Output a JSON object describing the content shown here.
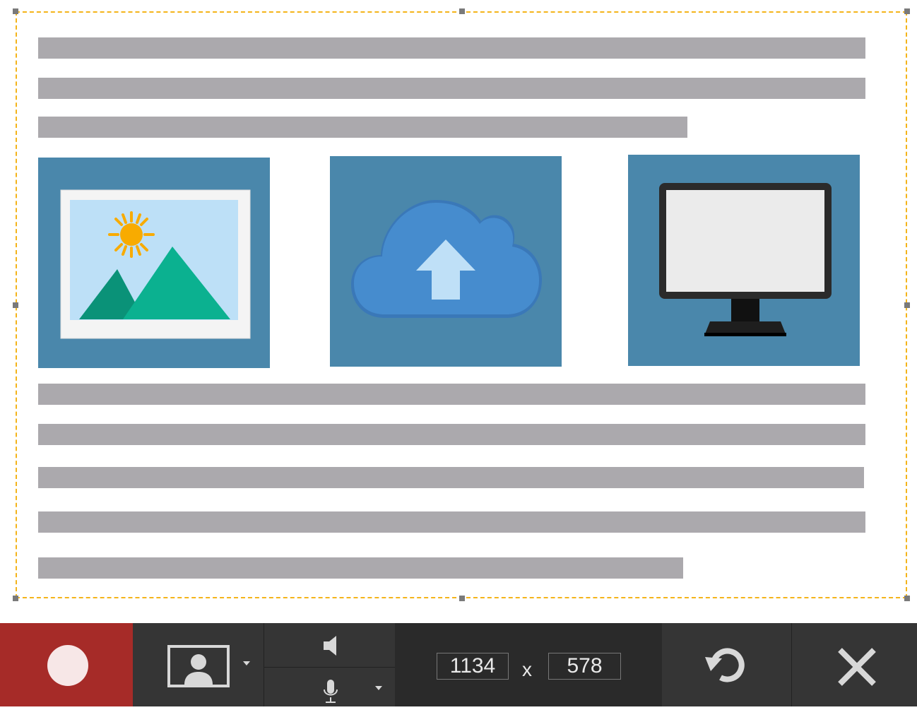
{
  "capture_area": {
    "icons": {
      "image_tile": "image-icon",
      "cloud_tile": "cloud-upload-icon",
      "monitor_tile": "monitor-icon"
    }
  },
  "toolbar": {
    "record_icon": "record-icon",
    "webcam_icon": "webcam-icon",
    "system_audio_icon": "speaker-icon",
    "mic_icon": "microphone-icon",
    "width": "1134",
    "separator": "x",
    "height": "578",
    "restart_icon": "restart-icon",
    "close_icon": "close-icon"
  },
  "colors": {
    "selection_border": "#f4b41a",
    "record_bg": "#a62b28",
    "toolbar_bg": "#2d2d2d",
    "tile_bg": "#4a87ab",
    "text_bar": "#aba9ad"
  }
}
